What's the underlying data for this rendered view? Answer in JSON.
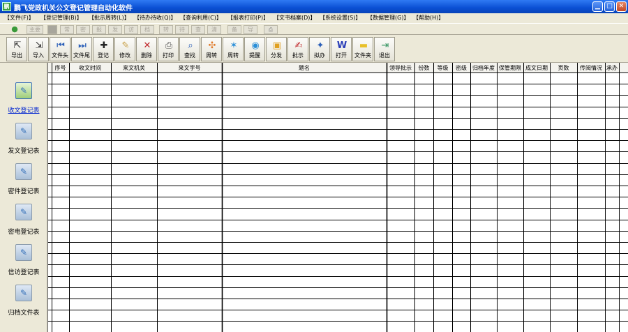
{
  "window": {
    "title": "鹏飞党政机关公文登记管理自动化软件",
    "icon_letter": "鹏"
  },
  "menu": [
    "【文件(F)】",
    "【登记管理(B)】",
    "【批示周转(L)】",
    "【待办待收(Q)】",
    "【查询利用(C)】",
    "【报表打印(P)】",
    "【文书档案(D)】",
    "【系统设置(S)】",
    "【数据管理(G)】",
    "【帮助(H)】"
  ],
  "quickbar": [
    "主要",
    "常",
    "密",
    "报",
    "发",
    "访",
    "档",
    "转",
    "待",
    "查",
    "清",
    "备",
    "导"
  ],
  "toolbar": [
    {
      "label": "导出",
      "icon": "export-icon"
    },
    {
      "label": "导入",
      "icon": "import-icon"
    },
    {
      "label": "文件头",
      "icon": "first-record-icon"
    },
    {
      "label": "文件尾",
      "icon": "last-record-icon"
    },
    {
      "label": "登记",
      "icon": "register-icon"
    },
    {
      "label": "修改",
      "icon": "edit-icon"
    },
    {
      "label": "删除",
      "icon": "delete-icon"
    },
    {
      "label": "打印",
      "icon": "printer-icon"
    },
    {
      "label": "查找",
      "icon": "search-icon"
    },
    {
      "label": "周转",
      "icon": "circulate-icon"
    },
    {
      "label": "周转",
      "icon": "circulate-star-icon"
    },
    {
      "label": "提醒",
      "icon": "reminder-icon"
    },
    {
      "label": "分发",
      "icon": "distribute-icon"
    },
    {
      "label": "批示",
      "icon": "instruct-icon"
    },
    {
      "label": "拟办",
      "icon": "draft-icon"
    },
    {
      "label": "打开",
      "icon": "word-open-icon"
    },
    {
      "label": "文件夹",
      "icon": "folder-icon"
    },
    {
      "label": "退出",
      "icon": "exit-icon"
    }
  ],
  "sidebar": [
    {
      "label": "收文登记表",
      "active": true
    },
    {
      "label": "发文登记表",
      "active": false
    },
    {
      "label": "密件登记表",
      "active": false
    },
    {
      "label": "密电登记表",
      "active": false
    },
    {
      "label": "信访登记表",
      "active": false
    },
    {
      "label": "归档文件表",
      "active": false
    }
  ],
  "table": {
    "columns": [
      "序号",
      "收文时间",
      "来文机关",
      "来文字号",
      "题名",
      "领导批示",
      "份数",
      "等级",
      "密级",
      "归档年度",
      "保管期限",
      "成文日期",
      "页数",
      "传阅情况",
      "承办"
    ],
    "rows": []
  },
  "colors": {
    "titlebar": "#0a4fd3",
    "face": "#ece9d8",
    "active_link": "#0024d0"
  }
}
